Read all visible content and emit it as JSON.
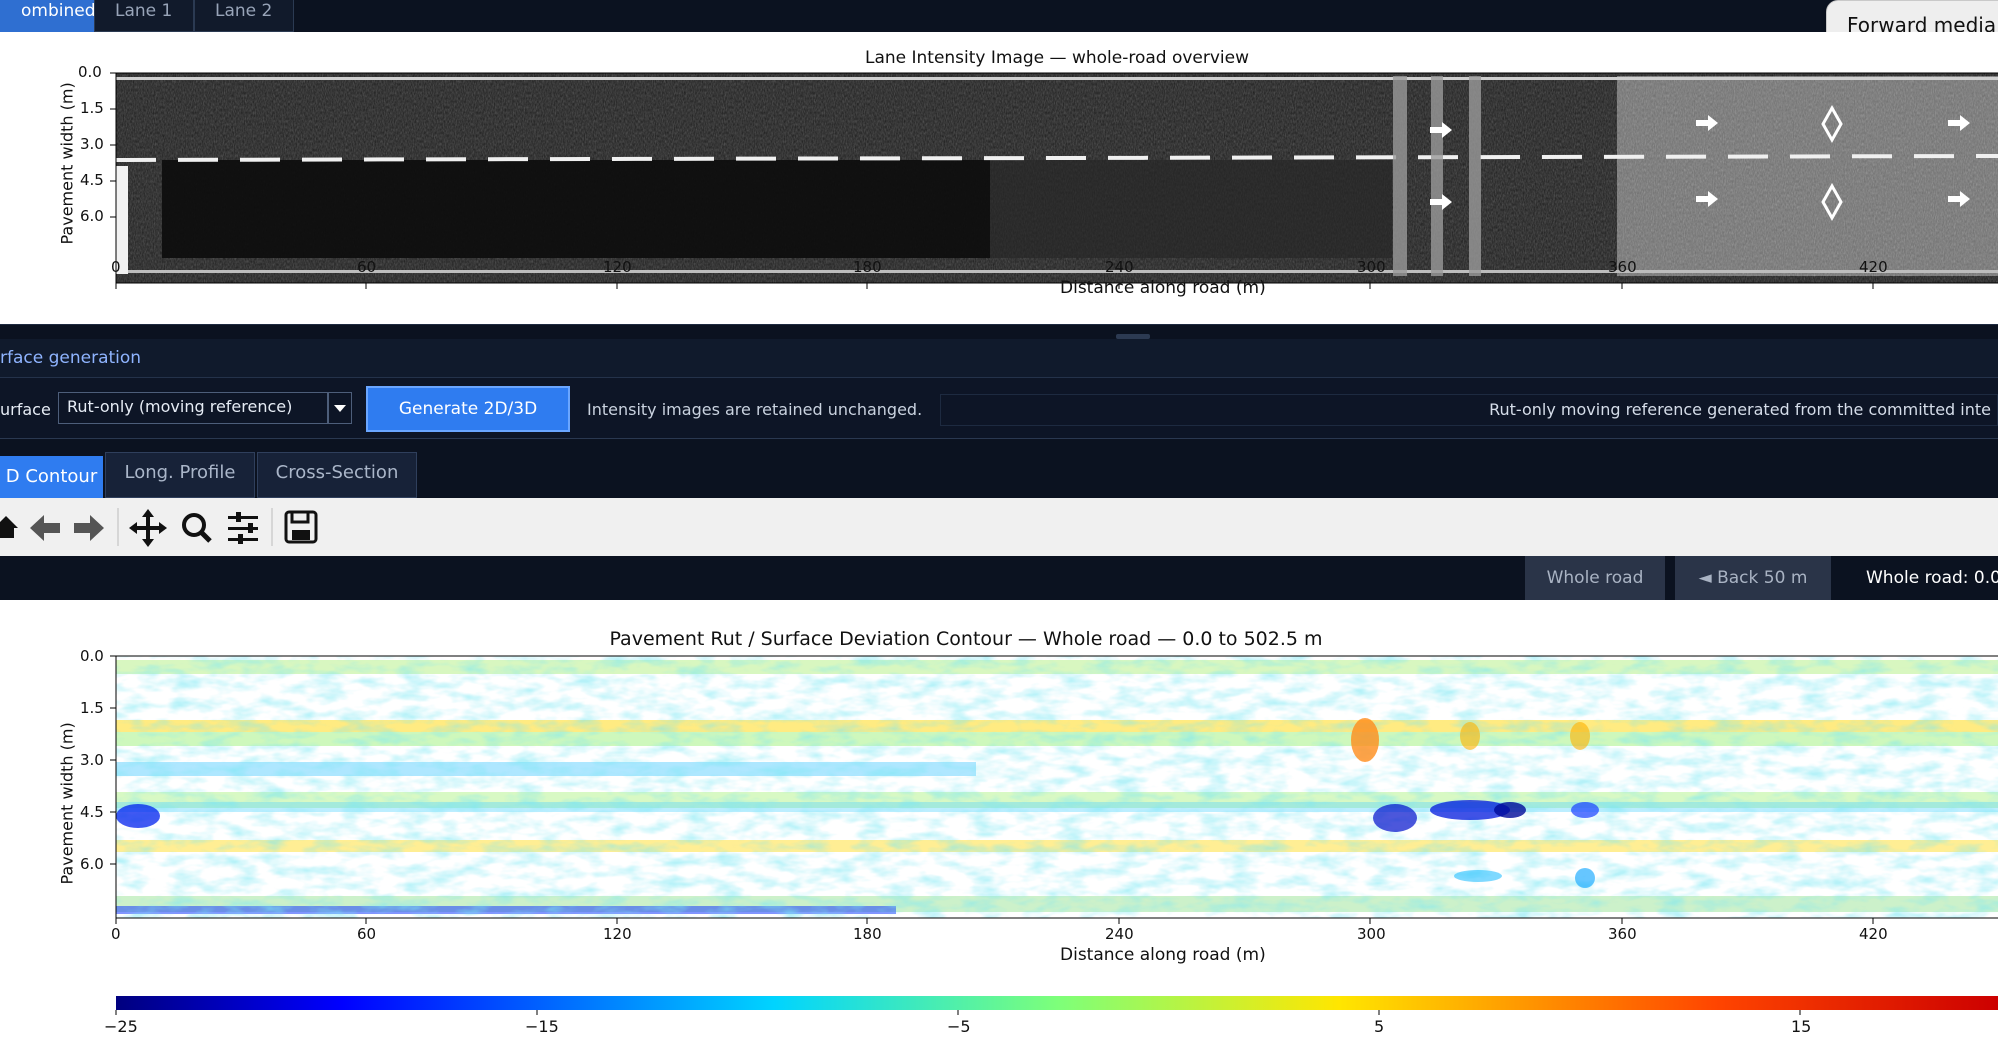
{
  "top_tabs": [
    "ombined",
    "Lane 1",
    "Lane 2"
  ],
  "forward_button": "Forward media",
  "intensity_plot": {
    "title": "Lane Intensity Image — whole-road overview",
    "xlabel": "Distance along road (m)",
    "ylabel": "Pavement width (m)",
    "x_ticks": [
      "0",
      "60",
      "120",
      "180",
      "240",
      "300",
      "360",
      "420"
    ],
    "y_ticks": [
      "0.0",
      "1.5",
      "3.0",
      "4.5",
      "6.0"
    ]
  },
  "surface_generation": {
    "title": "rface generation",
    "surface_label": "urface",
    "surface_value": "Rut-only (moving reference)",
    "generate_button": "Generate 2D/3D",
    "info_text": "Intensity images are retained unchanged.",
    "status_text": "Rut-only moving reference generated from the committed inte"
  },
  "view_tabs": [
    "D Contour",
    "Long. Profile",
    "Cross-Section"
  ],
  "toolbar_icons": [
    "home-icon",
    "back-arrow-icon",
    "forward-arrow-icon",
    "pan-icon",
    "zoom-icon",
    "configure-icon",
    "save-icon"
  ],
  "nav": {
    "whole_road_button": "Whole road",
    "back_button": "◄ Back 50 m",
    "range_label": "Whole road: 0.0"
  },
  "contour_plot": {
    "title": "Pavement Rut / Surface Deviation Contour — Whole road — 0.0 to 502.5 m",
    "xlabel": "Distance along road (m)",
    "ylabel": "Pavement width (m)",
    "x_ticks": [
      "0",
      "60",
      "120",
      "180",
      "240",
      "300",
      "360",
      "420"
    ],
    "y_ticks": [
      "0.0",
      "1.5",
      "3.0",
      "4.5",
      "6.0"
    ]
  },
  "colorbar": {
    "ticks": [
      "−25",
      "−15",
      "−5",
      "5",
      "15"
    ]
  }
}
